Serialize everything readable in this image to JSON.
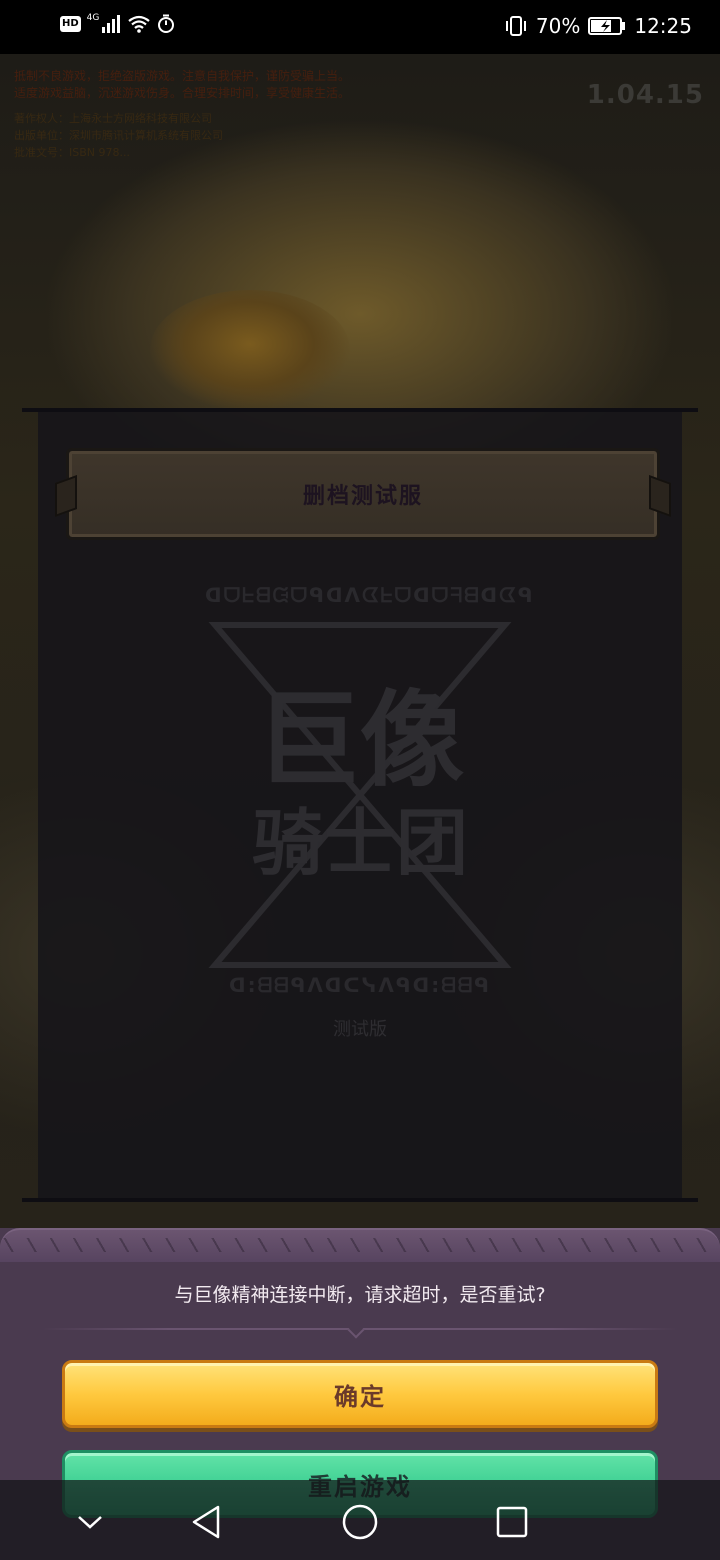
{
  "status_bar": {
    "hd_badge": "HD",
    "network": "4G",
    "battery_percent": "70%",
    "time": "12:25"
  },
  "game": {
    "notice_lines": [
      "抵制不良游戏，拒绝盗版游戏。注意自我保护，谨防受骗上当。",
      "适度游戏益脑，沉迷游戏伤身。合理安排时间，享受健康生活。"
    ],
    "info_lines": [
      "著作权人：上海永士方网络科技有限公司",
      "出版单位：深圳市腾讯计算机系统有限公司",
      "批准文号：ISBN 978..."
    ],
    "version": "1.04.15",
    "server_name": "删档测试服",
    "logo": {
      "runes_top": "ᗡᗜᖶᗺᙍᗜᑫᗡᐱᗧᖶᗜᗡᗜᖷᗺᗡᗧᑫ",
      "title_line1": "巨像",
      "title_line2": "骑士团",
      "runes_bottom": "ᗡ:ᗺᗺᑫᐱᗡᑕᓭᐱᑫᗡ:ᗺᗺᑫ",
      "subtitle": "测试版"
    }
  },
  "dialog": {
    "message": "与巨像精神连接中断，请求超时，是否重试?",
    "confirm_label": "确定",
    "restart_label": "重启游戏"
  },
  "colors": {
    "confirm_button": "#ffc93f",
    "restart_button": "#3dcf92",
    "dialog_bg": "#4a3a4f"
  }
}
